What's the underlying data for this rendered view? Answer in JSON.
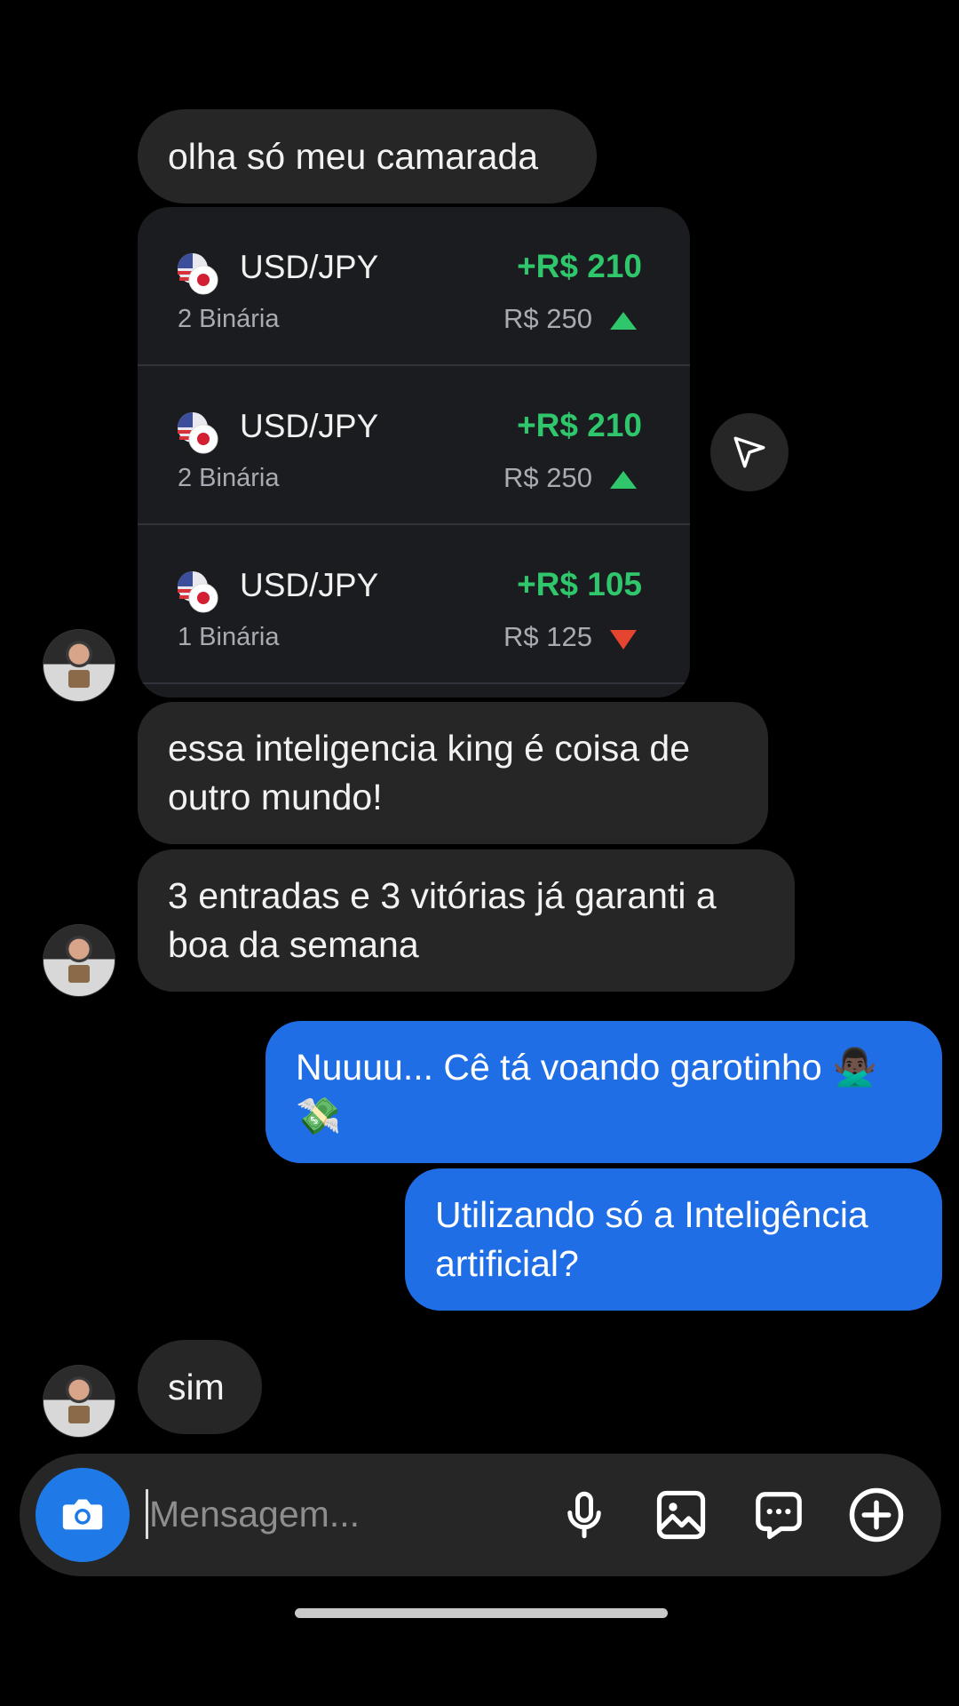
{
  "messages": [
    {
      "id": "m1",
      "text": "olha só meu camarada"
    },
    {
      "id": "m2",
      "text_line1": "essa inteligencia king é coisa de",
      "text_line2": "outro mundo!"
    },
    {
      "id": "m3",
      "text_line1": "3 entradas e 3 vitórias já garanti a",
      "text_line2": "boa da semana"
    },
    {
      "id": "m4",
      "text_line1": "Nuuuu... Cê tá voando garotinho 🙅🏿‍♂️",
      "text_line2": "💸"
    },
    {
      "id": "m5",
      "text_line1": "Utilizando só a Inteligência",
      "text_line2": "artificial?"
    },
    {
      "id": "m6",
      "text": "sim"
    }
  ],
  "trades": [
    {
      "pair": "USD/JPY",
      "type": "2 Binária",
      "profit": "+R$ 210",
      "stake": "R$ 250",
      "direction": "up"
    },
    {
      "pair": "USD/JPY",
      "type": "2 Binária",
      "profit": "+R$ 210",
      "stake": "R$ 250",
      "direction": "up"
    },
    {
      "pair": "USD/JPY",
      "type": "1 Binária",
      "profit": "+R$ 105",
      "stake": "R$ 125",
      "direction": "down"
    }
  ],
  "composer": {
    "placeholder": "Mensagem..."
  },
  "icons": {
    "camera": "camera-icon",
    "mic": "microphone-icon",
    "gallery": "image-icon",
    "sticker": "chat-bubble-icon",
    "add": "plus-circle-icon",
    "share": "send-icon"
  },
  "colors": {
    "incoming": "#262626",
    "outgoing": "#1f6ee6",
    "profit": "#2fc66c",
    "loss": "#e5452e"
  }
}
